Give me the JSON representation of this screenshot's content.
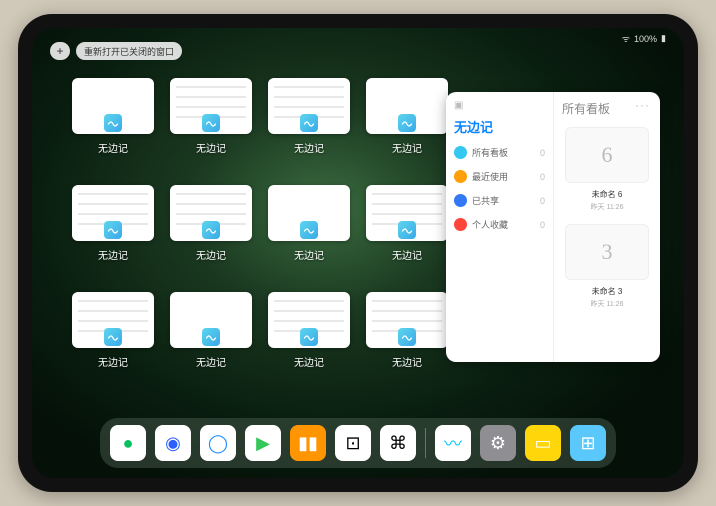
{
  "status": {
    "battery": "100%",
    "wifi": "􀙇"
  },
  "topbar": {
    "add": "+",
    "reopen_label": "重新打开已关闭的窗口"
  },
  "windows": [
    {
      "label": "无边记",
      "content": false
    },
    {
      "label": "无边记",
      "content": true
    },
    {
      "label": "无边记",
      "content": true
    },
    {
      "label": "无边记",
      "content": false
    },
    {
      "label": "无边记",
      "content": true
    },
    {
      "label": "无边记",
      "content": true
    },
    {
      "label": "无边记",
      "content": false
    },
    {
      "label": "无边记",
      "content": true
    },
    {
      "label": "无边记",
      "content": true
    },
    {
      "label": "无边记",
      "content": false
    },
    {
      "label": "无边记",
      "content": true
    },
    {
      "label": "无边记",
      "content": true
    }
  ],
  "panel": {
    "title": "无边记",
    "subtitle": "所有看板",
    "more": "···",
    "menu": [
      {
        "icon_color": "#34c7f0",
        "label": "所有看板",
        "count": "0"
      },
      {
        "icon_color": "#ff9f0a",
        "label": "最近使用",
        "count": "0"
      },
      {
        "icon_color": "#3478f6",
        "label": "已共享",
        "count": "0"
      },
      {
        "icon_color": "#ff453a",
        "label": "个人收藏",
        "count": "0"
      }
    ],
    "boards": [
      {
        "glyph": "6",
        "name": "未命名 6",
        "date": "昨天 11:26"
      },
      {
        "glyph": "3",
        "name": "未命名 3",
        "date": "昨天 11:26"
      }
    ]
  },
  "dock": [
    {
      "name": "wechat",
      "bg": "#ffffff",
      "fg": "#07c160",
      "glyph": "●"
    },
    {
      "name": "quark",
      "bg": "#ffffff",
      "fg": "#2b5fff",
      "glyph": "◉"
    },
    {
      "name": "qq-browser",
      "bg": "#ffffff",
      "fg": "#1e90ff",
      "glyph": "◯"
    },
    {
      "name": "play",
      "bg": "#ffffff",
      "fg": "#34c759",
      "glyph": "▶"
    },
    {
      "name": "books",
      "bg": "#ff9500",
      "fg": "#ffffff",
      "glyph": "▮▮"
    },
    {
      "name": "dice",
      "bg": "#ffffff",
      "fg": "#000000",
      "glyph": "⊡"
    },
    {
      "name": "graph",
      "bg": "#ffffff",
      "fg": "#000000",
      "glyph": "⌘"
    },
    {
      "name": "freeform",
      "bg": "#ffffff",
      "fg": "#00c4ff",
      "glyph": "〰"
    },
    {
      "name": "settings",
      "bg": "#8e8e93",
      "fg": "#ffffff",
      "glyph": "⚙"
    },
    {
      "name": "notes",
      "bg": "#ffd60a",
      "fg": "#ffffff",
      "glyph": "▭"
    },
    {
      "name": "app-library",
      "bg": "#5ac8fa",
      "fg": "#ffffff",
      "glyph": "⊞"
    }
  ]
}
